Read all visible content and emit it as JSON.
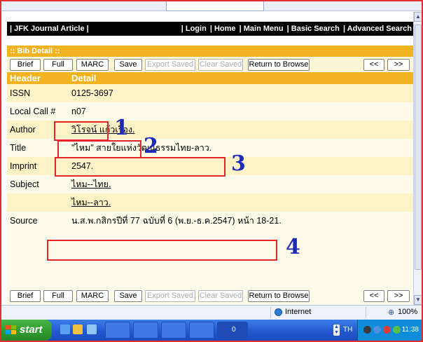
{
  "nav": {
    "left": "| JFK Journal Article |",
    "login": "| Login",
    "home": "| Home",
    "main_menu": "| Main Menu",
    "basic_search": "| Basic Search",
    "advanced_search": "| Advanced Search"
  },
  "bib": {
    "title": ":: Bib Detail ::",
    "buttons": {
      "brief": "Brief",
      "full": "Full",
      "marc": "MARC",
      "save": "Save",
      "export_saved": "Export Saved",
      "clear_saved": "Clear Saved",
      "return_to_browse": "Return to Browse",
      "prev": "<<",
      "next": ">>"
    },
    "header": {
      "col1": "Header",
      "col2": "Detail"
    },
    "rows": [
      {
        "label": "ISSN",
        "value": "0125-3697"
      },
      {
        "label": "Local Call #",
        "value": "n07"
      },
      {
        "label": "Author",
        "value": "วิโรจน์ แก้วเรือง."
      },
      {
        "label": "Title",
        "value": "\"ไหม\" สายใยแห่งวัฒนธรรมไทย-ลาว."
      },
      {
        "label": "Imprint",
        "value": "2547."
      },
      {
        "label": "Subject",
        "value": "ไหม--ไทย."
      },
      {
        "label": "",
        "value": "ไหม--ลาว."
      },
      {
        "label": "Source",
        "value": "น.ส.พ.กสิกรปีที่ 77 ฉบับที่ 6 (พ.ย.-ธ.ค.2547) หน้า 18-21."
      }
    ],
    "annotations": [
      "1",
      "2",
      "3",
      "4"
    ]
  },
  "status": {
    "zone": "Internet",
    "zoom": "100%"
  },
  "taskbar": {
    "start": "start",
    "lang": "TH",
    "clock": "11:38",
    "task_label": "0"
  },
  "colors": {
    "header_orange": "#f2b322",
    "odd_row": "#fdf3c6",
    "annotation_box": "#e8262a",
    "annotation_num": "#1d2bb8"
  },
  "icons": [
    "globe-icon",
    "zoom-icon",
    "windows-flag-icon",
    "ie-icon",
    "folder-icon",
    "speaker-icon",
    "network-icon"
  ]
}
